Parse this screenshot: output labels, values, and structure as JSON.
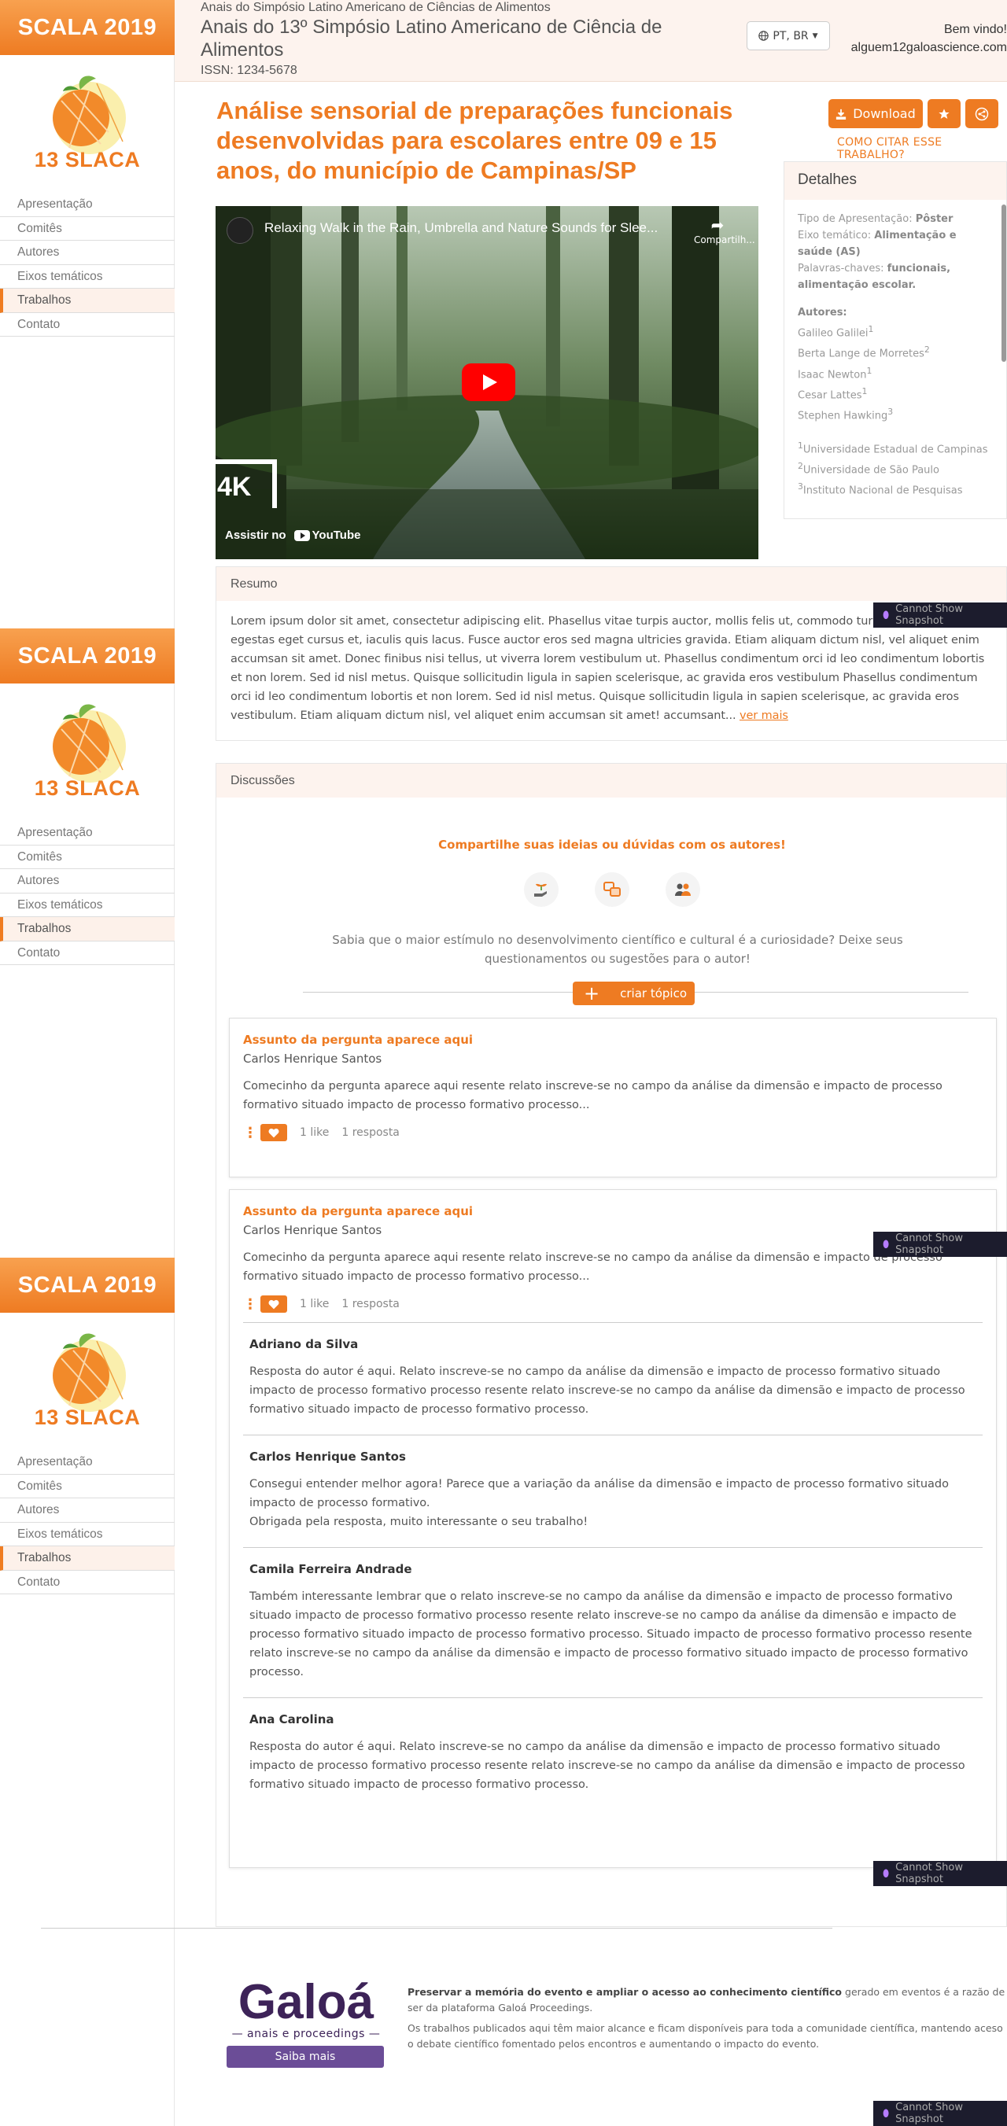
{
  "sidebar": {
    "brand": "SCALA 2019",
    "logo_text": "13 SLACA",
    "items": [
      {
        "label": "Apresentação"
      },
      {
        "label": "Comitês"
      },
      {
        "label": "Autores"
      },
      {
        "label": "Eixos temáticos"
      },
      {
        "label": "Trabalhos"
      },
      {
        "label": "Contato"
      }
    ],
    "active_item": "Trabalhos"
  },
  "header": {
    "small_title": "Anais do Simpósio Latino Americano de Ciências de Alimentos",
    "title": "Anais do 13º Simpósio Latino Americano de Ciência de Alimentos",
    "issn": "ISSN: 1234-5678",
    "language": "PT, BR",
    "welcome": "Bem vindo!",
    "user_email": "alguem12galoascience.com"
  },
  "paper": {
    "title": "Análise sensorial de preparações funcionais desenvolvidas para escolares entre 09 e 15 anos, do município de Campinas/SP",
    "download_label": "Download",
    "cite_label": "COMO CITAR ESSE TRABALHO?"
  },
  "video": {
    "title": "Relaxing Walk in the Rain, Umbrella and Nature Sounds for Slee...",
    "share_label": "Compartilh...",
    "badge": "4K",
    "watch_label": "Assistir no",
    "platform": "YouTube"
  },
  "details": {
    "heading": "Detalhes",
    "type_label": "Tipo de Apresentação:",
    "type_value": "Pôster",
    "axis_label": "Eixo temático:",
    "axis_value": "Alimentação e saúde (AS)",
    "keywords_label": "Palavras-chaves:",
    "keywords_value": "funcionais, alimentação escolar.",
    "authors_heading": "Autores:",
    "authors": [
      {
        "name": "Galileo Galilei",
        "sup": "1"
      },
      {
        "name": "Berta Lange de Morretes",
        "sup": "2"
      },
      {
        "name": "Isaac Newton",
        "sup": "1"
      },
      {
        "name": "Cesar Lattes",
        "sup": "1"
      },
      {
        "name": "Stephen Hawking",
        "sup": "3"
      }
    ],
    "affiliations": [
      {
        "sup": "1",
        "name": "Universidade Estadual de Campinas"
      },
      {
        "sup": "2",
        "name": "Universidade de São Paulo"
      },
      {
        "sup": "3",
        "name": "Instituto Nacional de Pesquisas"
      }
    ]
  },
  "resumo": {
    "heading": "Resumo",
    "text": "Lorem ipsum dolor sit amet, consectetur adipiscing elit. Phasellus vitae turpis auctor, mollis felis ut, commodo turpis. Cras mauris, egestas eget cursus et, iaculis quis lacus. Fusce auctor eros sed magna ultricies gravida. Etiam aliquam dictum nisl, vel aliquet enim accumsan sit amet. Donec finibus nisi tellus, ut viverra lorem vestibulum ut. Phasellus condimentum orci id leo condimentum lobortis et non lorem. Sed id nisl metus. Quisque sollicitudin ligula in sapien scelerisque, ac gravida eros vestibulum Phasellus condimentum orci id leo condimentum lobortis et non lorem. Sed id nisl metus. Quisque sollicitudin ligula in sapien scelerisque, ac gravida eros vestibulum. Etiam aliquam dictum nisl, vel aliquet enim accumsan sit amet! accumsant...",
    "see_more": "ver mais"
  },
  "discussions": {
    "heading": "Discussões",
    "cta": "Compartilhe suas ideias ou dúvidas com os autores!",
    "prompt": "Sabia que o maior estímulo no desenvolvimento científico e cultural é a curiosidade? Deixe seus questionamentos ou sugestões para o autor!",
    "create_label": "criar tópico",
    "posts": [
      {
        "subject": "Assunto da pergunta aparece aqui",
        "author": "Carlos Henrique Santos",
        "text": "Comecinho da pergunta aparece aqui resente relato inscreve-se no campo da análise da dimensão e impacto de processo formativo situado impacto de processo formativo processo...",
        "likes": "1 like",
        "replies": "1 resposta"
      },
      {
        "subject": "Assunto da pergunta aparece aqui",
        "author": "Carlos Henrique Santos",
        "text": "Comecinho da pergunta aparece aqui resente relato inscreve-se no campo da análise da dimensão e impacto de processo formativo situado impacto de processo formativo processo...",
        "likes": "1 like",
        "replies": "1 resposta",
        "thread": [
          {
            "name": "Adriano da Silva",
            "text": "Resposta do autor é aqui. Relato inscreve-se no campo da análise da dimensão e impacto de processo formativo situado impacto de processo formativo processo resente relato inscreve-se no campo da análise da dimensão e impacto de processo formativo situado impacto de processo formativo processo."
          },
          {
            "name": "Carlos Henrique Santos",
            "text": "Consegui entender melhor agora! Parece que a variação da análise da dimensão e impacto de processo formativo situado impacto de processo formativo.\nObrigada pela resposta, muito interessante o seu trabalho!"
          },
          {
            "name": "Camila Ferreira Andrade",
            "text": "Também interessante lembrar que o relato inscreve-se no campo da análise da dimensão e impacto de processo formativo situado impacto de processo formativo processo resente relato inscreve-se no campo da análise da dimensão e impacto de processo formativo situado impacto de processo formativo processo. Situado impacto de processo formativo processo resente relato inscreve-se no campo da análise da dimensão e impacto de processo formativo situado impacto de processo formativo processo."
          },
          {
            "name": "Ana Carolina",
            "text": "Resposta do autor é aqui. Relato inscreve-se no campo da análise da dimensão e impacto de processo formativo situado impacto de processo formativo processo resente relato inscreve-se no campo da análise da dimensão e impacto de processo formativo situado impacto de processo formativo processo."
          }
        ]
      }
    ]
  },
  "snapshot_label": "Cannot Show Snapshot",
  "footer": {
    "brand": "Galoá",
    "tagline": "— anais e proceedings —",
    "learn_more": "Saiba mais",
    "bold_text": "Preservar a memória do evento e ampliar o acesso ao conhecimento científico",
    "text1": "gerado em eventos é a razão de ser da plataforma Galoá Proceedings.",
    "text2": "Os trabalhos publicados aqui têm maior alcance e ficam disponíveis para toda a comunidade científica, mantendo aceso o debate científico fomentado pelos encontros e aumentando o impacto do evento."
  },
  "colors": {
    "accent": "#ee7b22",
    "header_bg": "#fdf3ee",
    "galoa": "#3d2358"
  }
}
